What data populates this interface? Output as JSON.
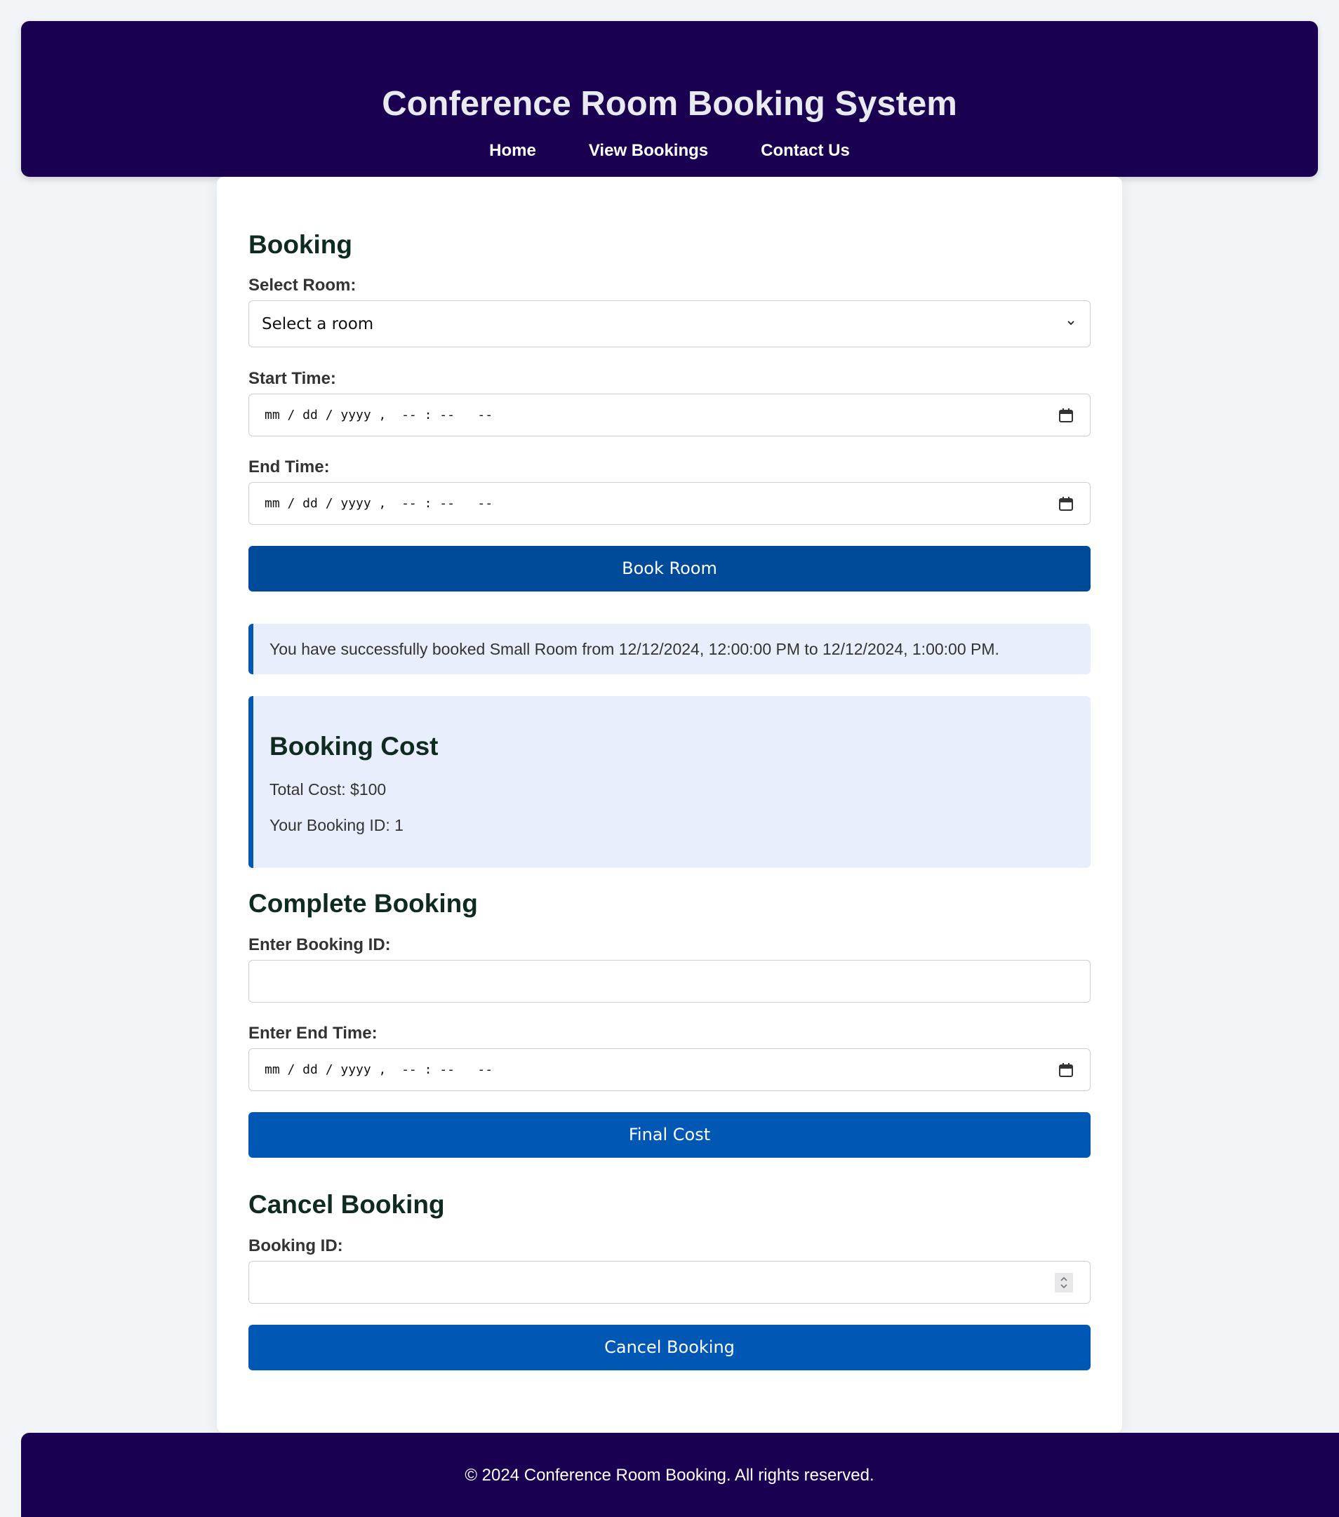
{
  "header": {
    "title": "Conference Room Booking System",
    "nav": [
      "Home",
      "View Bookings",
      "Contact Us"
    ]
  },
  "booking": {
    "heading": "Booking",
    "room_label": "Select Room:",
    "room_value": "Select a room",
    "start_label": "Start Time:",
    "start_placeholder": "mm / dd / yyyy ,  -- : --   --",
    "end_label": "End Time:",
    "end_placeholder": "mm / dd / yyyy ,  -- : --   --",
    "button": "Book Room"
  },
  "success_message": "You have successfully booked Small Room from 12/12/2024, 12:00:00 PM to 12/12/2024, 1:00:00 PM.",
  "cost": {
    "heading": "Booking Cost",
    "total": "Total Cost: $100",
    "booking_id": "Your Booking ID: 1"
  },
  "complete": {
    "heading": "Complete Booking",
    "id_label": "Enter Booking ID:",
    "id_value": "",
    "end_label": "Enter End Time:",
    "end_placeholder": "mm / dd / yyyy ,  -- : --   --",
    "button": "Final Cost"
  },
  "cancel": {
    "heading": "Cancel Booking",
    "id_label": "Booking ID:",
    "id_value": "",
    "button": "Cancel Booking"
  },
  "footer": {
    "text": "© 2024 Conference Room Booking. All rights reserved."
  },
  "colors": {
    "header_bg": "#1a0050",
    "primary_button": "#004a9a",
    "secondary_button": "#0057b4",
    "alert_bg": "#e8eefb"
  }
}
